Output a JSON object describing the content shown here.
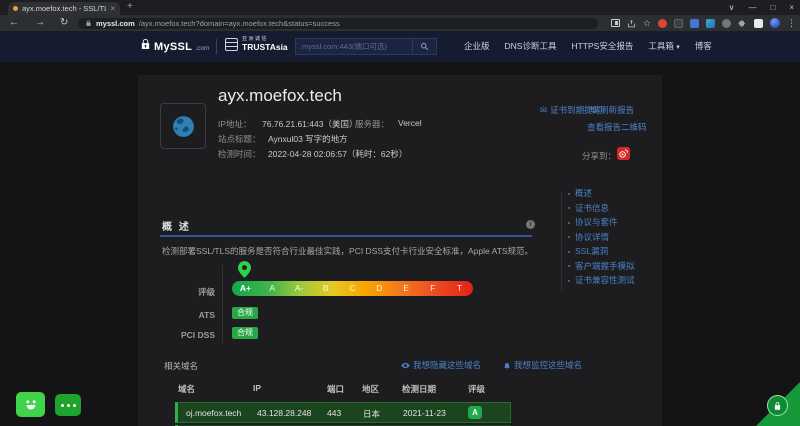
{
  "browser": {
    "tab_title": "ayx.moefox.tech - SSL/TLS安全",
    "url_domain": "myssl.com",
    "url_path": "/ayx.moefox.tech?domain=ayx.moefox.tech&status=success"
  },
  "icons": {
    "close": "×",
    "plus": "+",
    "chevron_down": "∨",
    "minimize": "—",
    "maximize": "□",
    "back": "←",
    "forward": "→",
    "reload": "↻",
    "star": "☆",
    "overflow": "⋮",
    "envelope": "✉",
    "refresh": "↻",
    "caret_down": "▾",
    "info": "i"
  },
  "header": {
    "brand": "MySSL",
    "brand_suffix": ".com",
    "partner_cn": "亚洲诚信",
    "partner_en": "TRUSTAsia",
    "search_placeholder": "myssl.com:443(端口可选)",
    "nav": [
      "企业版",
      "DNS诊断工具",
      "HTTPS安全报告",
      "工具箱",
      "博客"
    ]
  },
  "site": {
    "domain": "ayx.moefox.tech",
    "ip_label": "IP地址：",
    "ip_value": "76.76.21.61:443（美国）",
    "server_label": "服务器：",
    "server_value": "Vercel",
    "title_label": "站点标题：",
    "title_value": "Aynxul03 写字的地方",
    "time_label": "检测时间：",
    "time_value": "2022-04-28 02:06:57（耗时：62秒）",
    "actions": {
      "expiry_reminder": "证书到期提醒",
      "refresh_report": "刷新报告",
      "view_qrcode": "查看报告二维码",
      "share_label": "分享到："
    }
  },
  "overview": {
    "section_title": "概 述",
    "description": "检测部署SSL/TLS的服务是否符合行业最佳实践，PCI DSS支付卡行业安全标准，Apple ATS规范。",
    "rating_label": "评级",
    "grades": [
      "A+",
      "A",
      "A-",
      "B",
      "C",
      "D",
      "E",
      "F",
      "T"
    ],
    "current_grade": "A+",
    "ats_label": "ATS",
    "ats_value": "合规",
    "pci_label": "PCI DSS",
    "pci_value": "合规"
  },
  "sidebar": {
    "items": [
      "概述",
      "证书信息",
      "协议与套件",
      "协议详情",
      "SSL漏洞",
      "客户端握手模拟",
      "证书兼容性测试"
    ]
  },
  "related": {
    "title": "相关域名",
    "hide_link": "我想隐藏这些域名",
    "monitor_link": "我想监控这些域名",
    "columns": [
      "域名",
      "IP",
      "端口",
      "地区",
      "检测日期",
      "评级"
    ],
    "rows": [
      {
        "domain": "oj.moefox.tech",
        "ip": "43.128.28.248",
        "port": "443",
        "region": "日本",
        "date": "2021-11-23",
        "grade": "A"
      }
    ]
  },
  "colors": {
    "accent_blue": "#4a83c9",
    "badge_green": "#28a745",
    "header_navy": "#151c30",
    "grade_green": "#0fa74e",
    "grade_red": "#e02214"
  }
}
